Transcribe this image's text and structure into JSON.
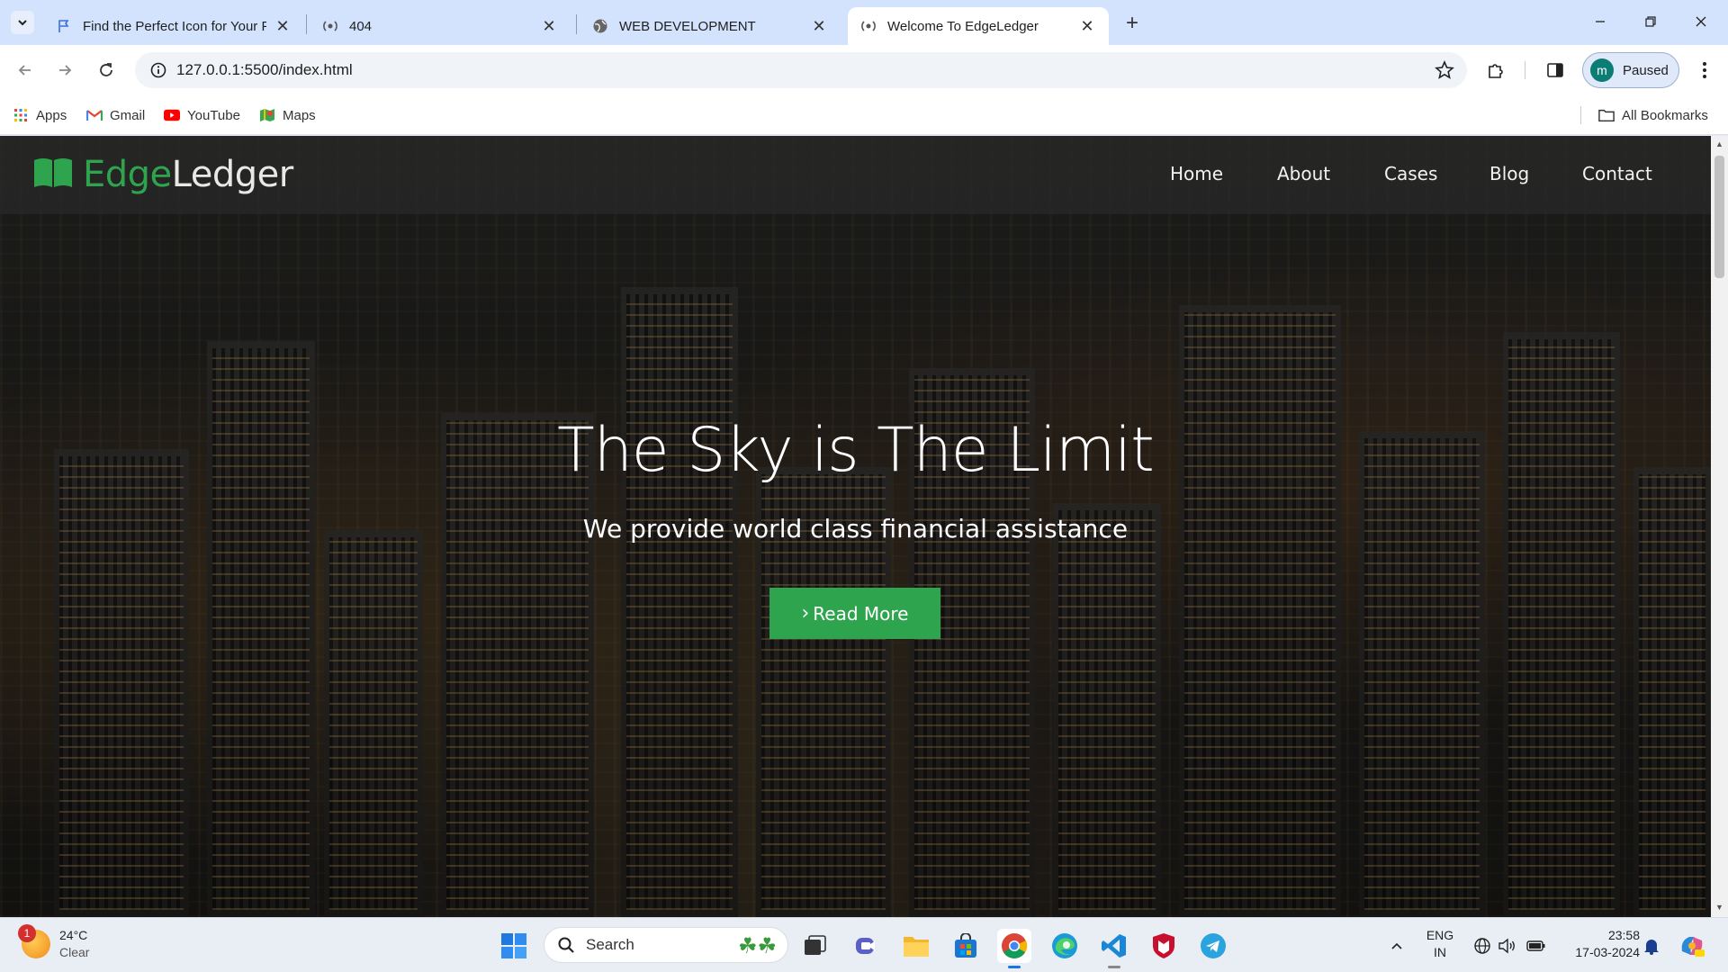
{
  "browser": {
    "tabs": [
      {
        "title": "Find the Perfect Icon for Your Pr",
        "active": false
      },
      {
        "title": "404",
        "active": false
      },
      {
        "title": "WEB DEVELOPMENT",
        "active": false
      },
      {
        "title": "Welcome To EdgeLedger",
        "active": true
      }
    ],
    "url": "127.0.0.1:5500/index.html",
    "profile": {
      "initial": "m",
      "status": "Paused"
    },
    "bookmarks": [
      {
        "label": "Apps",
        "icon": "apps-grid-icon"
      },
      {
        "label": "Gmail",
        "icon": "gmail-icon"
      },
      {
        "label": "YouTube",
        "icon": "youtube-icon"
      },
      {
        "label": "Maps",
        "icon": "maps-icon"
      }
    ],
    "all_bookmarks": "All Bookmarks"
  },
  "site": {
    "logo": {
      "part1": "Edge",
      "part2": "Ledger"
    },
    "nav": [
      "Home",
      "About",
      "Cases",
      "Blog",
      "Contact"
    ],
    "hero": {
      "title": "The Sky is The Limit",
      "subtitle": "We provide world class financial assistance",
      "button": "Read More"
    },
    "colors": {
      "accent": "#2ea44f"
    }
  },
  "taskbar": {
    "weather": {
      "temp": "24°C",
      "condition": "Clear",
      "badge": "1"
    },
    "search_label": "Search",
    "language": {
      "line1": "ENG",
      "line2": "IN"
    },
    "time": "23:58",
    "date": "17-03-2024"
  }
}
